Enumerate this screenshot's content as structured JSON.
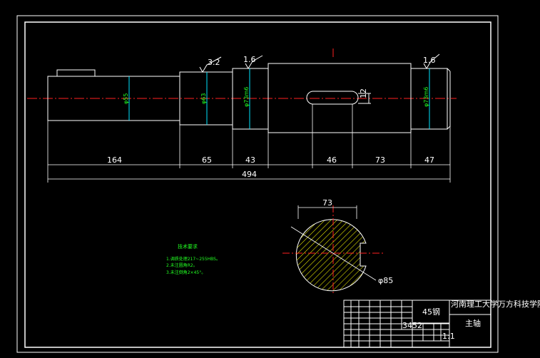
{
  "drawing": {
    "dimensions": {
      "d164": "164",
      "d65": "65",
      "d43": "43",
      "d46": "46",
      "d73": "73",
      "d47": "47",
      "d494": "494",
      "section_width": "73",
      "section_diameter": "φ85"
    },
    "diameter_labels": {
      "d55": "φ55",
      "d63": "φ63",
      "d73m6_a": "φ73m6",
      "d73m6_b": "φ73m6"
    },
    "roughness_values": {
      "r1": "3.2",
      "r2": "1.6",
      "r3": "1.6"
    },
    "keyway_label": "12",
    "tech_requirements": {
      "title": "技术要求",
      "items": [
        "1.调质处理217~255HBS。",
        "2.未注圆角R2。",
        "3.未注倒角2×45°。"
      ]
    },
    "title_block": {
      "material": "45钢",
      "school": "河南理工大学万方科技学院",
      "part_name": "主轴",
      "scale": "1:1",
      "code": "3452"
    }
  },
  "colors": {
    "outline": "#ffffff",
    "centerline": "#ff2020",
    "dimension_line": "#00e5ff",
    "text_green": "#22ff22",
    "hatch": "#ffff00"
  }
}
